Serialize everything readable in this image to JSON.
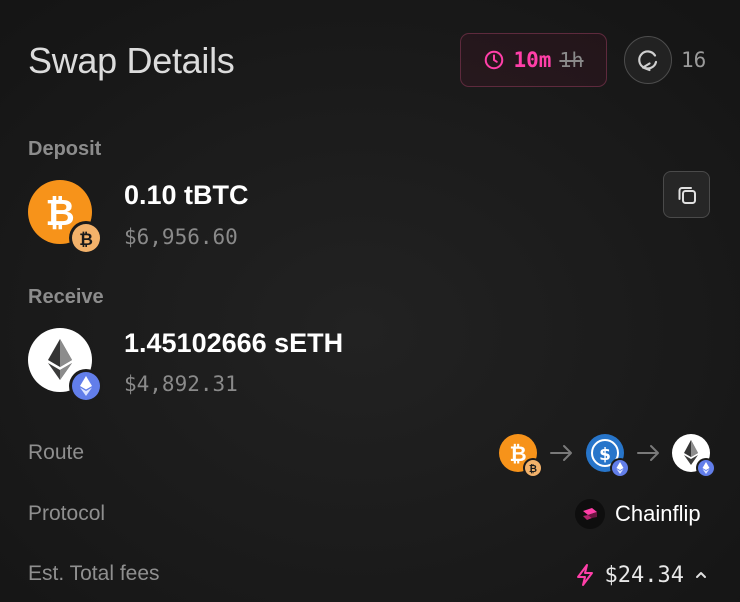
{
  "header": {
    "title": "Swap Details",
    "timer_current": "10m",
    "timer_previous": "1h",
    "refresh_count": "16"
  },
  "deposit": {
    "label": "Deposit",
    "amount": "0.10 tBTC",
    "usd": "$6,956.60",
    "icon": "bitcoin-icon",
    "chain_icon": "bitcoin-chain-icon"
  },
  "receive": {
    "label": "Receive",
    "amount": "1.45102666 sETH",
    "usd": "$4,892.31",
    "icon": "ethereum-icon",
    "chain_icon": "ethereum-chain-icon"
  },
  "details": {
    "route_label": "Route",
    "route_steps": [
      "bitcoin-icon",
      "usdc-icon",
      "ethereum-icon"
    ],
    "protocol_label": "Protocol",
    "protocol_name": "Chainflip",
    "fees_label": "Est. Total fees",
    "fees_value": "$24.34"
  },
  "colors": {
    "accent_pink": "#ff3fa8",
    "bitcoin_orange": "#f7931a",
    "ethereum_blue": "#627eea",
    "usdc_blue": "#2775ca"
  }
}
